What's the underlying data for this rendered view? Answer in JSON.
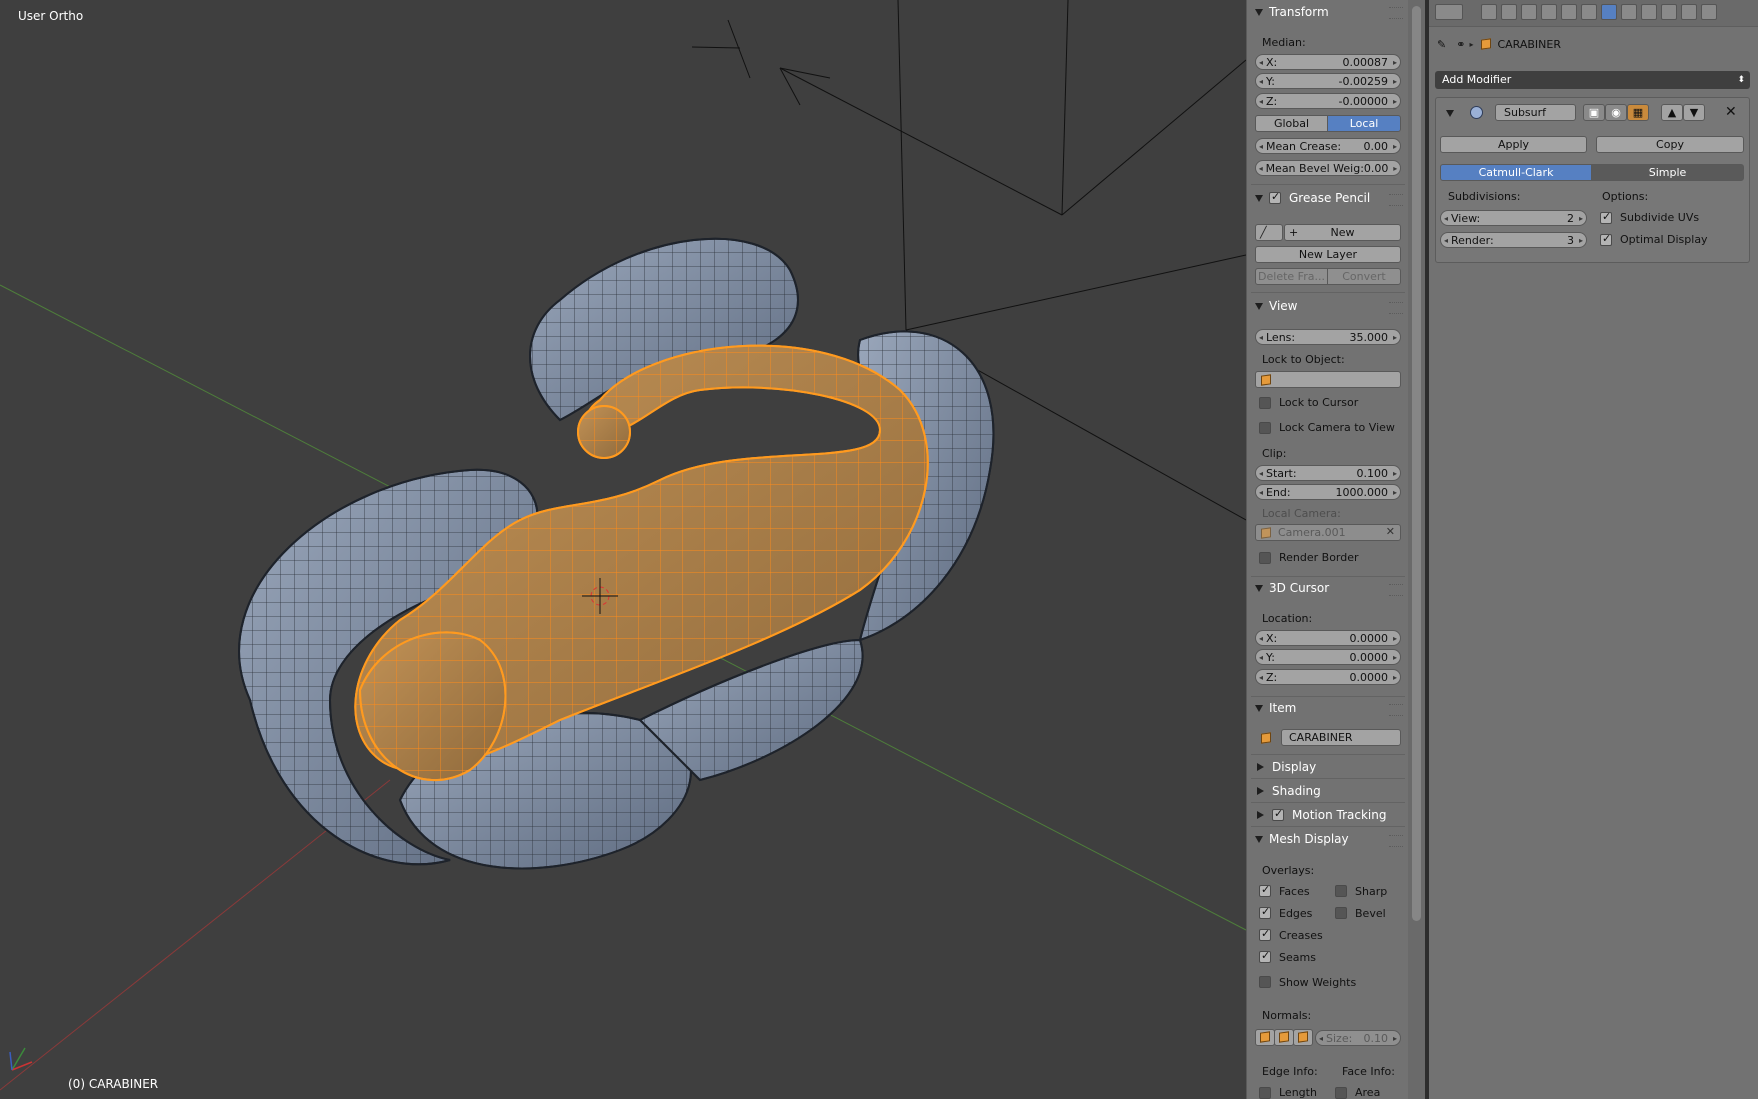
{
  "viewport": {
    "view_label": "User Ortho",
    "object_label": "(0) CARABINER"
  },
  "npanel": {
    "transform": {
      "title": "Transform",
      "median_label": "Median:",
      "x": {
        "label": "X:",
        "value": "0.00087"
      },
      "y": {
        "label": "Y:",
        "value": "-0.00259"
      },
      "z": {
        "label": "Z:",
        "value": "-0.00000"
      },
      "global_label": "Global",
      "local_label": "Local",
      "mean_crease": {
        "label": "Mean Crease:",
        "value": "0.00"
      },
      "mean_bevel": {
        "label": "Mean Bevel Weig:",
        "value": "0.00"
      }
    },
    "grease_pencil": {
      "title": "Grease Pencil",
      "new_label": "New",
      "new_layer_label": "New Layer",
      "delete_frame_label": "Delete Fra...",
      "convert_label": "Convert"
    },
    "view": {
      "title": "View",
      "lens": {
        "label": "Lens:",
        "value": "35.000"
      },
      "lock_to_object_label": "Lock to Object:",
      "lock_to_cursor_label": "Lock to Cursor",
      "lock_camera_label": "Lock Camera to View",
      "clip_label": "Clip:",
      "start": {
        "label": "Start:",
        "value": "0.100"
      },
      "end": {
        "label": "End:",
        "value": "1000.000"
      },
      "local_camera_label": "Local Camera:",
      "local_camera_value": "Camera.001",
      "render_border_label": "Render Border"
    },
    "cursor": {
      "title": "3D Cursor",
      "location_label": "Location:",
      "x": {
        "label": "X:",
        "value": "0.0000"
      },
      "y": {
        "label": "Y:",
        "value": "0.0000"
      },
      "z": {
        "label": "Z:",
        "value": "0.0000"
      }
    },
    "item": {
      "title": "Item",
      "name": "CARABINER"
    },
    "collapsed": {
      "display": "Display",
      "shading": "Shading",
      "motion_tracking": "Motion Tracking"
    },
    "mesh_display": {
      "title": "Mesh Display",
      "overlays_label": "Overlays:",
      "faces": "Faces",
      "sharp": "Sharp",
      "edges": "Edges",
      "bevel": "Bevel",
      "creases": "Creases",
      "seams": "Seams",
      "show_weights": "Show Weights",
      "normals_label": "Normals:",
      "size": {
        "label": "Size:",
        "value": "0.10"
      },
      "edge_info_label": "Edge Info:",
      "face_info_label": "Face Info:",
      "length": "Length",
      "area": "Area"
    }
  },
  "properties": {
    "object_name": "CARABINER",
    "add_modifier_label": "Add Modifier",
    "modifier": {
      "name": "Subsurf",
      "apply_label": "Apply",
      "copy_label": "Copy",
      "catmull_label": "Catmull-Clark",
      "simple_label": "Simple",
      "subdivisions_label": "Subdivisions:",
      "view": {
        "label": "View:",
        "value": "2"
      },
      "render": {
        "label": "Render:",
        "value": "3"
      },
      "options_label": "Options:",
      "subdivide_uvs_label": "Subdivide UVs",
      "optimal_display_label": "Optimal Display"
    }
  },
  "colors": {
    "selection_orange": "#ff9a1f",
    "mesh_blue_grey": "#8a97ab",
    "active_blue": "#5680c2",
    "viewport_bg": "#3f3f3f"
  }
}
